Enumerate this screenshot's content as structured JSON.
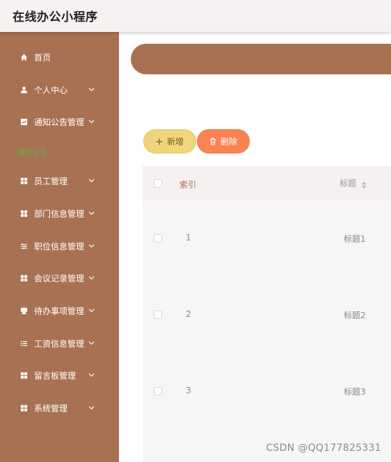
{
  "app": {
    "title": "在线办公小程序"
  },
  "sidebar": {
    "items": [
      {
        "label": "首页",
        "icon": "home-icon",
        "has_chevron": false
      },
      {
        "label": "个人中心",
        "icon": "user-icon",
        "has_chevron": true
      },
      {
        "label": "通知公告管理",
        "icon": "chart-icon",
        "has_chevron": true
      },
      {
        "label": "员工管理",
        "icon": "grid-icon",
        "has_chevron": true
      },
      {
        "label": "部门信息管理",
        "icon": "grid-icon",
        "has_chevron": true
      },
      {
        "label": "职位信息管理",
        "icon": "sliders-icon",
        "has_chevron": true
      },
      {
        "label": "会议记录管理",
        "icon": "grid-icon",
        "has_chevron": true
      },
      {
        "label": "待办事项管理",
        "icon": "printer-icon",
        "has_chevron": true
      },
      {
        "label": "工资信息管理",
        "icon": "list-icon",
        "has_chevron": true
      },
      {
        "label": "留言板管理",
        "icon": "grid-icon",
        "has_chevron": true
      },
      {
        "label": "系统管理",
        "icon": "grid-icon",
        "has_chevron": true
      }
    ],
    "submenu_active": "通知公告"
  },
  "toolbar": {
    "add_label": "新增",
    "delete_label": "删除"
  },
  "table": {
    "columns": [
      "索引",
      "标题"
    ],
    "rows": [
      {
        "index": "1",
        "title": "标题1"
      },
      {
        "index": "2",
        "title": "标题2"
      },
      {
        "index": "3",
        "title": "标题3"
      }
    ]
  },
  "watermark": "CSDN @QQ177825331",
  "colors": {
    "sidebar": "#a87252",
    "add_button": "#f0d57a",
    "delete_button": "#fb8352",
    "submenu_text": "#6ea84c"
  }
}
